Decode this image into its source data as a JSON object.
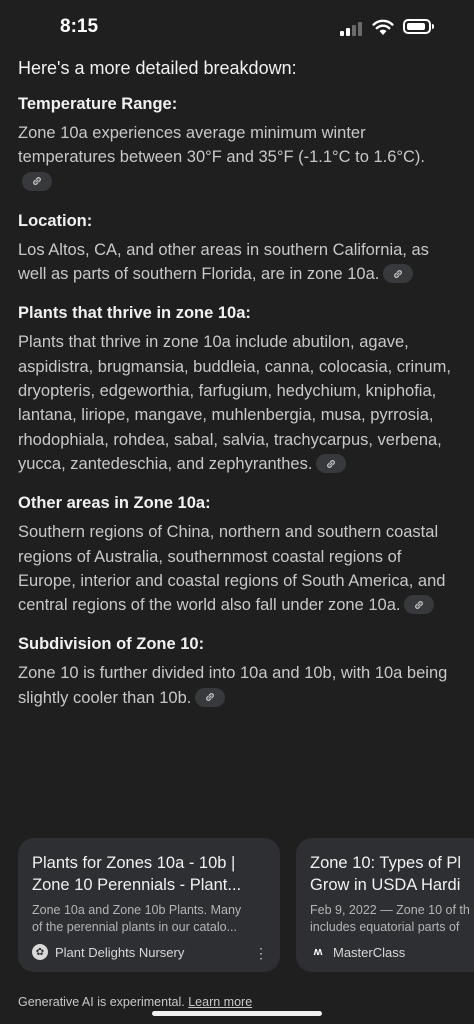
{
  "status": {
    "time": "8:15"
  },
  "intro": "Here's a more detailed breakdown:",
  "sections": [
    {
      "title": "Temperature Range:",
      "body": "Zone 10a experiences average minimum winter temperatures between 30°F and 35°F (-1.1°C to 1.6°C)."
    },
    {
      "title": "Location:",
      "body": "Los Altos, CA, and other areas in southern California, as well as parts of southern Florida, are in zone 10a."
    },
    {
      "title": "Plants that thrive in zone 10a:",
      "body": "Plants that thrive in zone 10a include abutilon, agave, aspidistra, brugmansia, buddleia, canna, colocasia, crinum, dryopteris, edgeworthia, farfugium, hedychium, kniphofia, lantana, liriope, mangave, muhlenbergia, musa, pyrrosia, rhodophiala, rohdea, sabal, salvia, trachycarpus, verbena, yucca, zantedeschia, and zephyranthes."
    },
    {
      "title": "Other areas in Zone 10a:",
      "body": "Southern regions of China, northern and southern coastal regions of Australia, southernmost coastal regions of Europe, interior and coastal regions of South America, and central regions of the world also fall under zone 10a."
    },
    {
      "title": "Subdivision of Zone 10:",
      "body": "Zone 10 is further divided into 10a and 10b, with 10a being slightly cooler than 10b."
    }
  ],
  "cards": [
    {
      "title_line1": "Plants for Zones 10a - 10b |",
      "title_line2": "Zone 10 Perennials - Plant...",
      "snippet_line1": "Zone 10a and Zone 10b Plants. Many",
      "snippet_line2": "of the perennial plants in our catalo...",
      "source": "Plant Delights Nursery"
    },
    {
      "title_line1": "Zone 10: Types of Pl",
      "title_line2": "Grow in USDA Hardi",
      "snippet_line1": "Feb 9, 2022 — Zone 10 of th",
      "snippet_line2": "includes equatorial parts of",
      "source": "MasterClass"
    }
  ],
  "footer": {
    "text": "Generative AI is experimental.",
    "link": "Learn more"
  },
  "icons": {
    "link": "link-icon",
    "menu": "more-vert-icon"
  }
}
